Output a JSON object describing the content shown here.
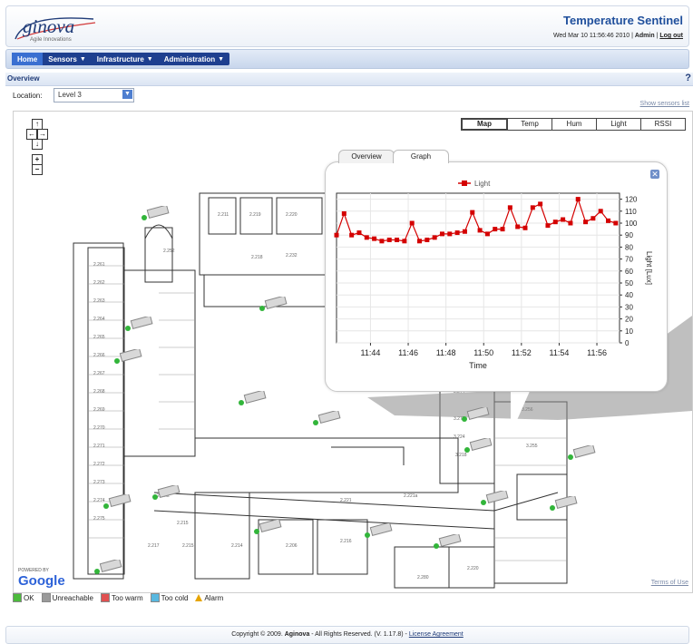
{
  "header": {
    "logo_text": "ginova",
    "logo_tagline": "Agile Innovations",
    "app_title": "Temperature Sentinel",
    "datetime": "Wed Mar 10 11:56:46 2010 |",
    "user": "Admin",
    "logout": "Log out"
  },
  "nav": {
    "items": [
      {
        "label": "Home"
      },
      {
        "label": "Sensors"
      },
      {
        "label": "Infrastructure"
      },
      {
        "label": "Administration"
      }
    ]
  },
  "overview": {
    "title": "Overview",
    "help": "?",
    "location_label": "Location:",
    "location_value": "Level 3",
    "show_sensors_list": "Show sensors list"
  },
  "map": {
    "types": [
      "Map",
      "Temp",
      "Hum",
      "Light",
      "RSSI"
    ],
    "active_type": "Map",
    "powered_by": "POWERED BY",
    "google": "Google",
    "terms": "Terms of Use",
    "controls": [
      "↑",
      "←",
      "→",
      "↓",
      "+",
      "−"
    ]
  },
  "popup": {
    "tabs": [
      "Overview",
      "Graph"
    ],
    "active_tab": "Graph",
    "close": "✕"
  },
  "chart_data": {
    "type": "line",
    "title": "",
    "legend": [
      "Light"
    ],
    "xlabel": "Time",
    "ylabel": "Light [Lux]",
    "ylim": [
      0,
      125
    ],
    "yticks": [
      0,
      10,
      20,
      30,
      40,
      50,
      60,
      70,
      80,
      90,
      100,
      110,
      120
    ],
    "xticks": [
      "11:44",
      "11:46",
      "11:48",
      "11:50",
      "11:52",
      "11:54",
      "11:56"
    ],
    "xrange_minutes": [
      42.2,
      57.2
    ],
    "series": [
      {
        "name": "Light",
        "color": "#d40000",
        "x": [
          42.2,
          42.6,
          43.0,
          43.4,
          43.8,
          44.2,
          44.6,
          45.0,
          45.4,
          45.8,
          46.2,
          46.6,
          47.0,
          47.4,
          47.8,
          48.2,
          48.6,
          49.0,
          49.4,
          49.8,
          50.2,
          50.6,
          51.0,
          51.4,
          51.8,
          52.2,
          52.6,
          53.0,
          53.4,
          53.8,
          54.2,
          54.6,
          55.0,
          55.4,
          55.8,
          56.2,
          56.6,
          57.0
        ],
        "y": [
          90,
          108,
          90,
          92,
          88,
          87,
          85,
          86,
          86,
          85,
          100,
          85,
          86,
          88,
          91,
          91,
          92,
          93,
          109,
          94,
          91,
          95,
          95,
          113,
          97,
          96,
          113,
          116,
          98,
          101,
          103,
          100,
          120,
          101,
          104,
          110,
          102,
          100
        ]
      }
    ]
  },
  "legend": [
    {
      "label": "OK",
      "color": "#4cbb3c"
    },
    {
      "label": "Unreachable",
      "color": "#9a9a9a"
    },
    {
      "label": "Too warm",
      "color": "#e05050"
    },
    {
      "label": "Too cold",
      "color": "#58b8e0"
    },
    {
      "label": "Alarm",
      "color": "#e6a400"
    }
  ],
  "footer": {
    "text": "Copyright © 2009.",
    "brand": "Aginova",
    "rest": "- All Rights Reserved. (V. 1.17.8) -",
    "license": "License Agreement"
  }
}
